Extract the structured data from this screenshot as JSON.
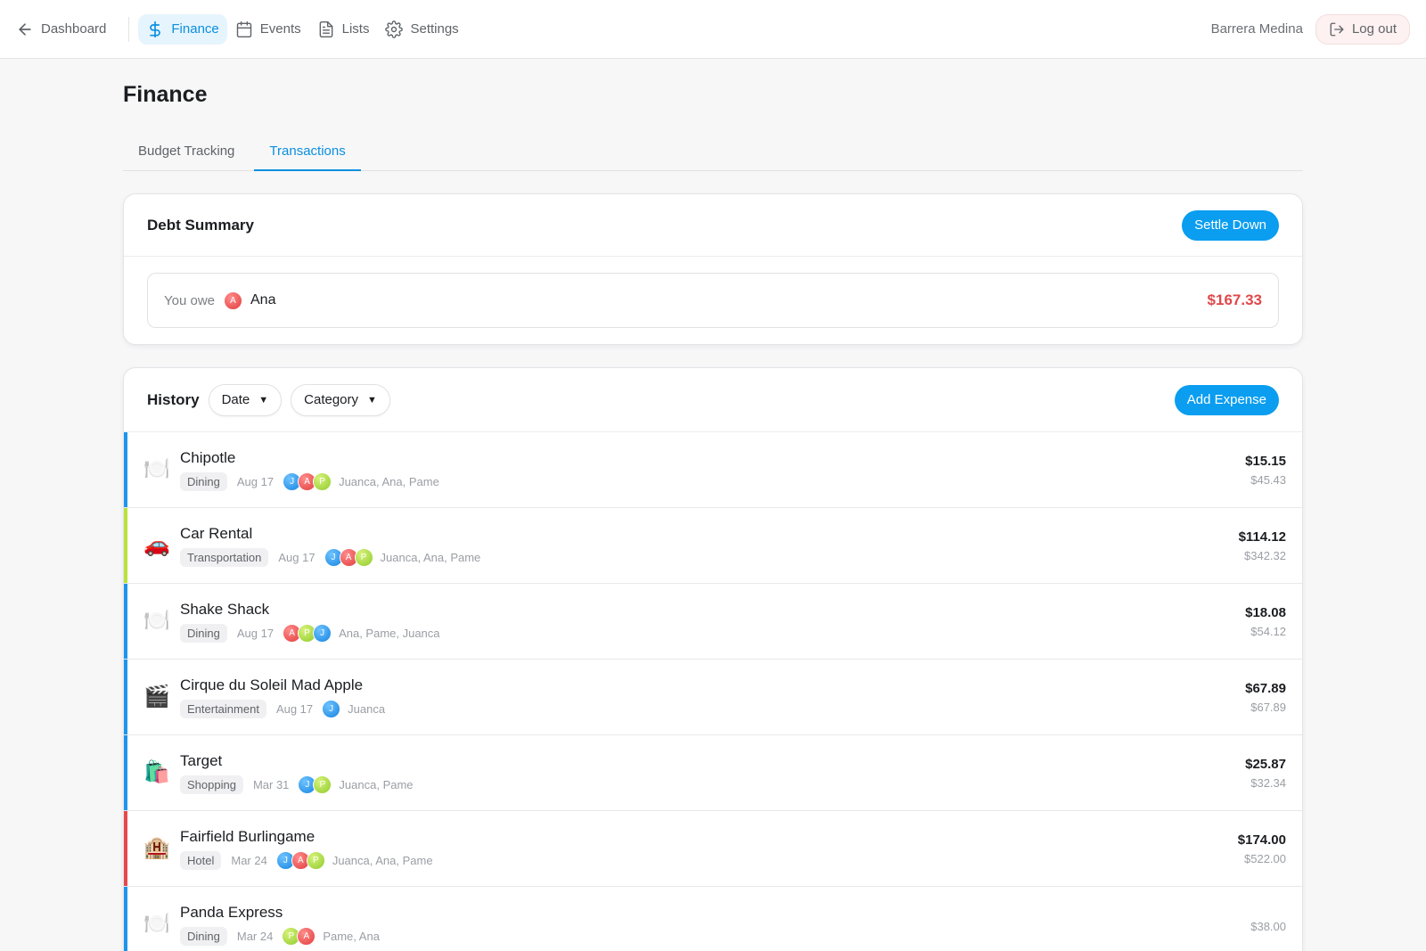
{
  "nav": {
    "back_label": "Dashboard",
    "items": [
      {
        "label": "Finance",
        "icon": "dollar-icon",
        "active": true
      },
      {
        "label": "Events",
        "icon": "calendar-icon",
        "active": false
      },
      {
        "label": "Lists",
        "icon": "document-icon",
        "active": false
      },
      {
        "label": "Settings",
        "icon": "gear-icon",
        "active": false
      }
    ],
    "user_name": "Barrera Medina",
    "logout_label": "Log out"
  },
  "page": {
    "title": "Finance",
    "tabs": [
      {
        "label": "Budget Tracking",
        "active": false
      },
      {
        "label": "Transactions",
        "active": true
      }
    ]
  },
  "debt": {
    "title": "Debt Summary",
    "settle_label": "Settle Down",
    "owe_label": "You owe",
    "person_initial": "A",
    "person_name": "Ana",
    "amount": "$167.33"
  },
  "history": {
    "title": "History",
    "filters": {
      "date_label": "Date",
      "category_label": "Category"
    },
    "add_label": "Add Expense",
    "rows": [
      {
        "name": "Chipotle",
        "category": "Dining",
        "date": "Aug 17",
        "people": "Juanca, Ana, Pame",
        "share": "$15.15",
        "total": "$45.43"
      },
      {
        "name": "Car Rental",
        "category": "Transportation",
        "date": "Aug 17",
        "people": "Juanca, Ana, Pame",
        "share": "$114.12",
        "total": "$342.32"
      },
      {
        "name": "Shake Shack",
        "category": "Dining",
        "date": "Aug 17",
        "people": "Ana, Pame, Juanca",
        "share": "$18.08",
        "total": "$54.12"
      },
      {
        "name": "Cirque du Soleil Mad Apple",
        "category": "Entertainment",
        "date": "Aug 17",
        "people": "Juanca",
        "share": "$67.89",
        "total": "$67.89"
      },
      {
        "name": "Target",
        "category": "Shopping",
        "date": "Mar 31",
        "people": "Juanca, Pame",
        "share": "$25.87",
        "total": "$32.34"
      },
      {
        "name": "Fairfield Burlingame",
        "category": "Hotel",
        "date": "Mar 24",
        "people": "Juanca, Ana, Pame",
        "share": "$174.00",
        "total": "$522.00"
      },
      {
        "name": "Panda Express",
        "category": "Dining",
        "date": "Mar 24",
        "people": "Pame, Ana",
        "share": "",
        "total": "$38.00"
      }
    ]
  },
  "colors": {
    "accent": "#0a9df0",
    "debt_red": "#e0484c",
    "dining_bar": "#1e95ea",
    "transport_bar": "#b9e23b",
    "hotel_bar": "#e5484d"
  }
}
